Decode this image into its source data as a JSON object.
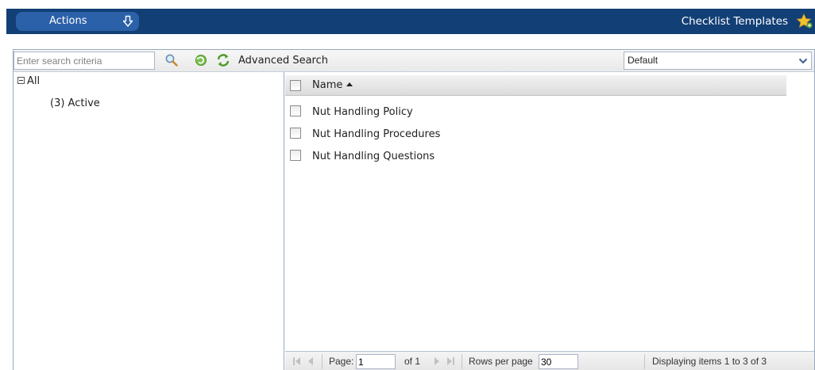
{
  "header": {
    "actions_label": "Actions",
    "app_title": "Checklist Templates"
  },
  "toolbar": {
    "search_placeholder": "Enter search criteria",
    "advanced_search_label": "Advanced Search",
    "view_selected": "Default"
  },
  "tree": {
    "root_label": "All",
    "children": [
      {
        "label": "(3) Active"
      }
    ]
  },
  "grid": {
    "columns": [
      {
        "label": "Name",
        "sort": "ascending"
      }
    ],
    "rows": [
      {
        "name": "Nut Handling Policy"
      },
      {
        "name": "Nut Handling Procedures"
      },
      {
        "name": "Nut Handling Questions"
      }
    ]
  },
  "pager": {
    "page_label": "Page:",
    "page_value": "1",
    "of_label": "of 1",
    "rows_label": "Rows per page",
    "rows_value": "30",
    "status": "Displaying items 1 to 3 of 3"
  },
  "colors": {
    "header_bg": "#123f76",
    "actions_button_bg": "#2b61a8",
    "panel_border": "#9aa9bd"
  }
}
